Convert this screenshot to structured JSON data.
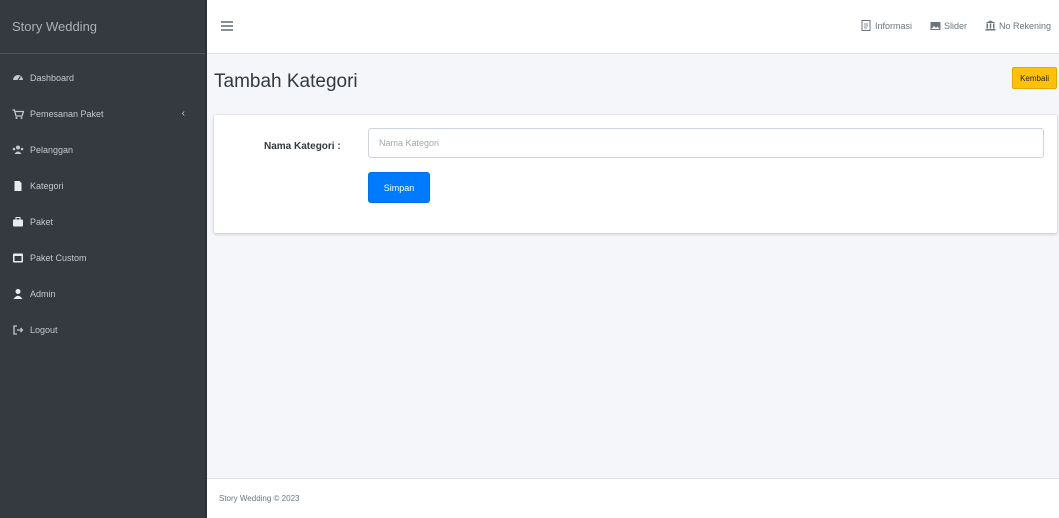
{
  "brand": {
    "title": "Story Wedding"
  },
  "sidebar": {
    "items": [
      {
        "label": "Dashboard",
        "icon": "tachometer-icon"
      },
      {
        "label": "Pemesanan Paket",
        "icon": "cart-icon"
      },
      {
        "label": "Pelanggan",
        "icon": "users-icon"
      },
      {
        "label": "Kategori",
        "icon": "file-icon"
      },
      {
        "label": "Paket",
        "icon": "briefcase-icon"
      },
      {
        "label": "Paket Custom",
        "icon": "window-icon"
      },
      {
        "label": "Admin",
        "icon": "user-icon"
      },
      {
        "label": "Logout",
        "icon": "sign-out-icon"
      }
    ]
  },
  "navbar": {
    "links": [
      {
        "label": "Informasi",
        "icon": "document-icon"
      },
      {
        "label": "Slider",
        "icon": "image-icon"
      },
      {
        "label": "No Rekening",
        "icon": "bank-icon"
      }
    ]
  },
  "header": {
    "title": "Tambah Kategori",
    "back_label": "Kembali"
  },
  "form": {
    "label": "Nama Kategori :",
    "placeholder": "Nama Kategori",
    "submit_label": "Simpan"
  },
  "footer": {
    "text": "Story Wedding © 2023"
  },
  "colors": {
    "sidebar_bg": "#343a40",
    "primary": "#007bff",
    "warning": "#ffc107"
  }
}
